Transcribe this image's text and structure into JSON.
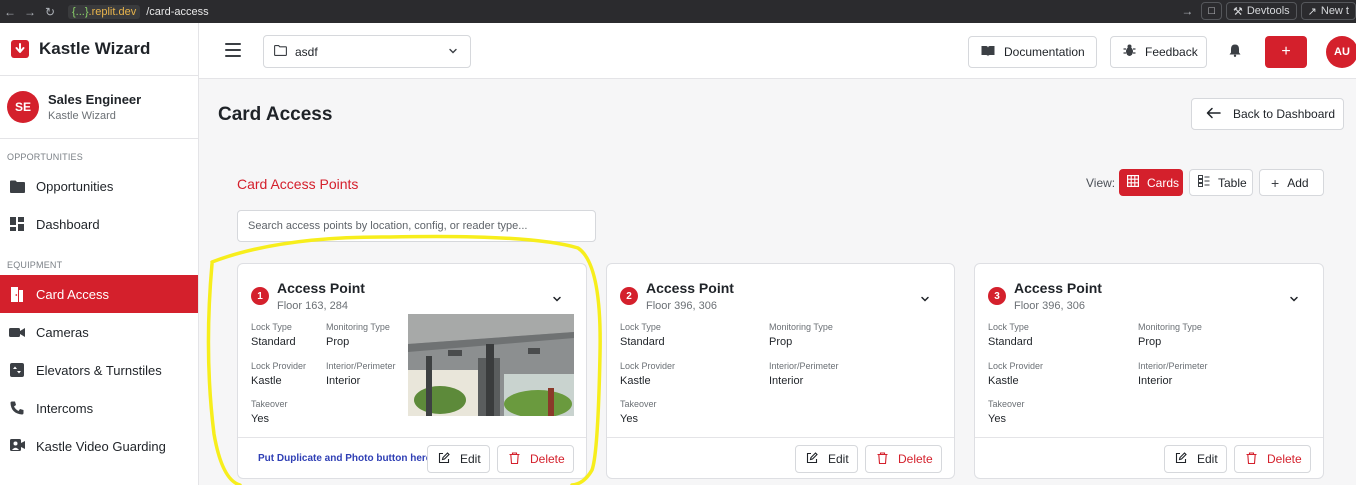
{
  "browser": {
    "url_brace": "{...}",
    "url_host": ".replit.dev",
    "url_path": "/card-access",
    "devtools_label": "Devtools",
    "new_tab_label": "New t"
  },
  "sidebar": {
    "brand": "Kastle Wizard",
    "user": {
      "initials": "SE",
      "name": "Sales Engineer",
      "org": "Kastle Wizard"
    },
    "opportunities_label": "OPPORTUNITIES",
    "opportunities_items": [
      {
        "label": "Opportunities",
        "icon": "folder-icon"
      },
      {
        "label": "Dashboard",
        "icon": "dashboard-icon"
      }
    ],
    "equipment_label": "EQUIPMENT",
    "equipment_items": [
      {
        "label": "Card Access",
        "icon": "door-icon",
        "active": true
      },
      {
        "label": "Cameras",
        "icon": "camera-icon"
      },
      {
        "label": "Elevators & Turnstiles",
        "icon": "elevator-icon"
      },
      {
        "label": "Intercoms",
        "icon": "phone-icon"
      },
      {
        "label": "Kastle Video Guarding",
        "icon": "video-guard-icon"
      }
    ]
  },
  "topbar": {
    "project": "asdf",
    "documentation": "Documentation",
    "feedback": "Feedback",
    "add_symbol": "+",
    "avatar": "AU"
  },
  "main": {
    "title": "Card Access",
    "back_label": "Back to Dashboard",
    "section_title": "Card Access Points",
    "view_label": "View:",
    "view_cards": "Cards",
    "view_table": "Table",
    "add_label": "Add",
    "search_placeholder": "Search access points by location, config, or reader type...",
    "field_labels": {
      "lock_type": "Lock Type",
      "monitoring_type": "Monitoring Type",
      "lock_provider": "Lock Provider",
      "interior_perimeter": "Interior/Perimeter",
      "takeover": "Takeover"
    },
    "edit_label": "Edit",
    "delete_label": "Delete",
    "duplicate_note": "Put Duplicate and Photo button here",
    "cards": [
      {
        "num": "1",
        "title": "Access Point",
        "location": "Floor 163, 284",
        "lock_type": "Standard",
        "monitoring_type": "Prop",
        "lock_provider": "Kastle",
        "interior_perimeter": "Interior",
        "takeover": "Yes"
      },
      {
        "num": "2",
        "title": "Access Point",
        "location": "Floor 396, 306",
        "lock_type": "Standard",
        "monitoring_type": "Prop",
        "lock_provider": "Kastle",
        "interior_perimeter": "Interior",
        "takeover": "Yes"
      },
      {
        "num": "3",
        "title": "Access Point",
        "location": "Floor 396, 306",
        "lock_type": "Standard",
        "monitoring_type": "Prop",
        "lock_provider": "Kastle",
        "interior_perimeter": "Interior",
        "takeover": "Yes"
      }
    ]
  },
  "colors": {
    "brand_red": "#d4202c",
    "highlight_yellow": "#f7ee1c",
    "note_blue": "#2f3fb5"
  }
}
